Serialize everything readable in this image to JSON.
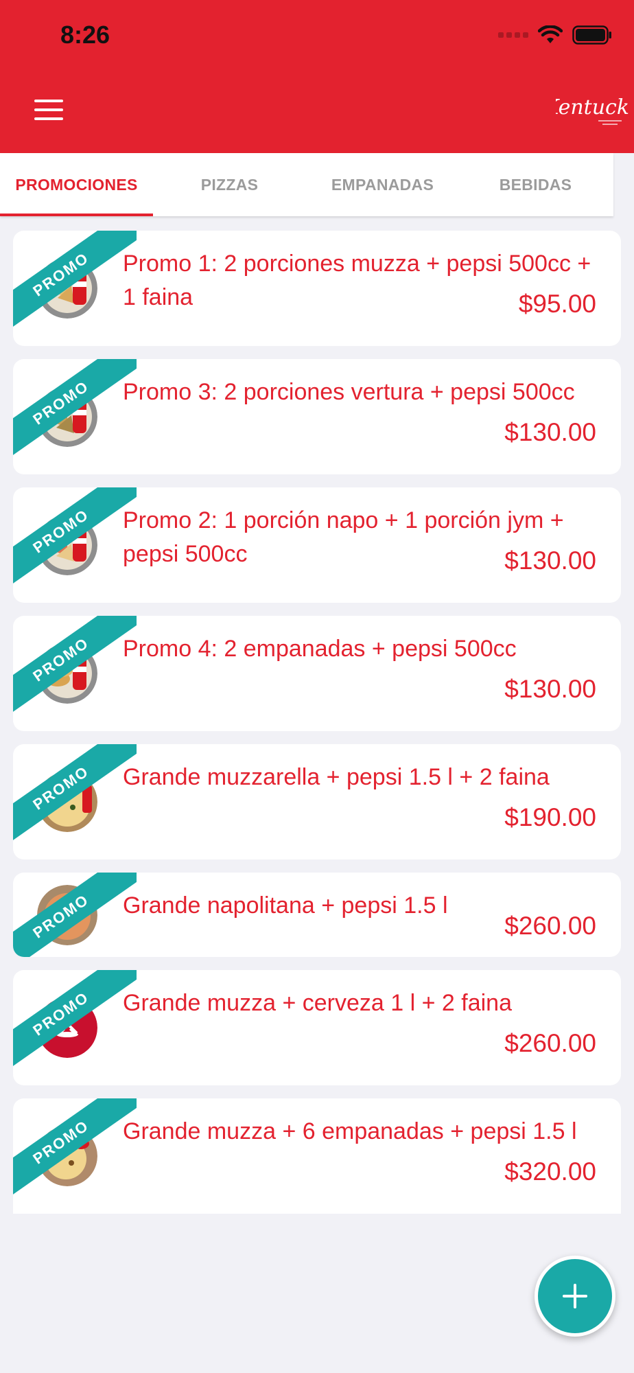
{
  "status_bar": {
    "time": "8:26"
  },
  "header": {
    "menu_icon": "hamburger-icon",
    "logo": "Kentucky",
    "brand_color": "#E3222F"
  },
  "tabs": [
    {
      "label": "PROMOCIONES",
      "active": true
    },
    {
      "label": "PIZZAS",
      "active": false
    },
    {
      "label": "EMPANADAS",
      "active": false
    },
    {
      "label": "BEBIDAS",
      "active": false
    }
  ],
  "promo_badge": "PROMO",
  "items": [
    {
      "title": "Promo 1: 2 porciones muzza + pepsi 500cc + 1 faina",
      "price": "$95.00",
      "thumb": "pizza-slices-pepsi"
    },
    {
      "title": "Promo 3: 2 porciones vertura + pepsi 500cc",
      "price": "$130.00",
      "thumb": "pizza-slices-pepsi"
    },
    {
      "title": "Promo 2: 1 porción napo + 1 porción jym + pepsi 500cc",
      "price": "$130.00",
      "thumb": "pizza-slices-pepsi"
    },
    {
      "title": "Promo 4: 2 empanadas + pepsi 500cc",
      "price": "$130.00",
      "thumb": "empanadas-pepsi"
    },
    {
      "title": "Grande muzzarella + pepsi 1.5 l + 2 faina",
      "price": "$190.00",
      "thumb": "whole-pizza"
    },
    {
      "title": "Grande napolitana + pepsi 1.5 l",
      "price": "$260.00",
      "thumb": "napolitana-pizza"
    },
    {
      "title": "Grande muzza + cerveza 1 l + 2 faina",
      "price": "$260.00",
      "thumb": "brand-logo"
    },
    {
      "title": "Grande muzza + 6 empanadas + pepsi 1.5 l",
      "price": "$320.00",
      "thumb": "pizza-empanadas"
    }
  ],
  "fab": {
    "icon": "plus-icon",
    "color": "#1AA9A7"
  }
}
